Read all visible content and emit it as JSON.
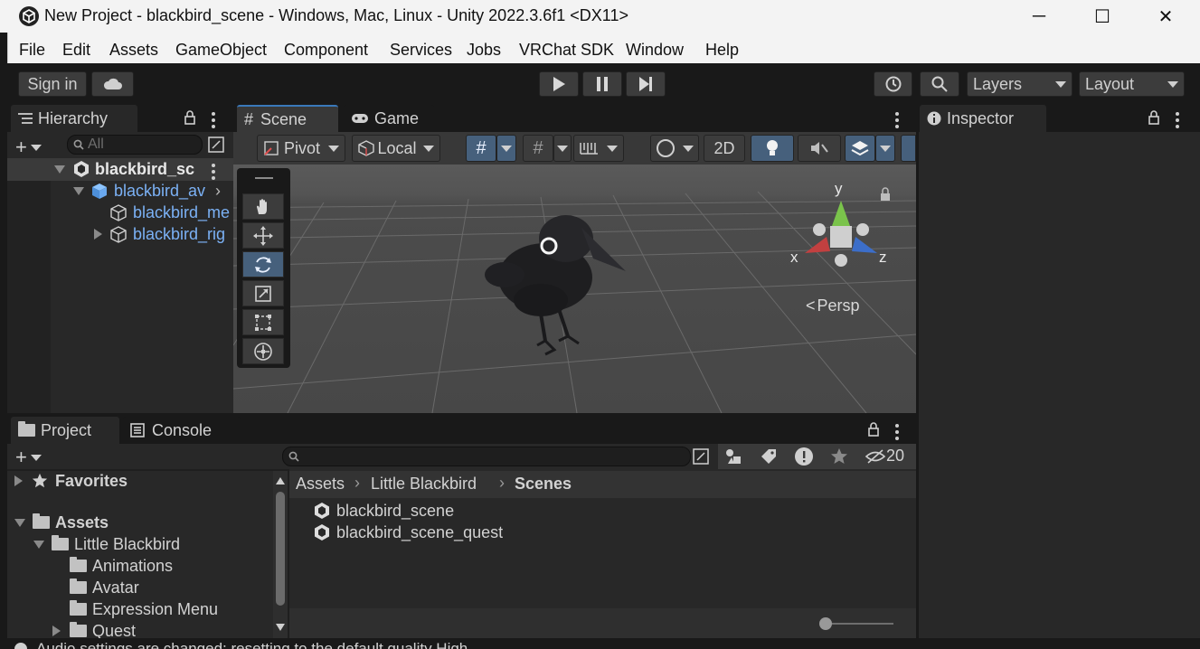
{
  "window": {
    "title": "New Project - blackbird_scene - Windows, Mac, Linux - Unity 2022.3.6f1 <DX11>",
    "minimize_glyph": "─",
    "maximize_glyph": "☐",
    "close_glyph": "✕"
  },
  "menu": [
    "File",
    "Edit",
    "Assets",
    "GameObject",
    "Component",
    "Services",
    "Jobs",
    "VRChat SDK",
    "Window",
    "Help"
  ],
  "toolbar": {
    "sign_in": "Sign in",
    "layers": "Layers",
    "layout": "Layout"
  },
  "hierarchy": {
    "tab": "Hierarchy",
    "search_placeholder": "All",
    "rows": [
      "blackbird_sc",
      "blackbird_av",
      "blackbird_me",
      "blackbird_rig"
    ]
  },
  "scene": {
    "tab_scene": "Scene",
    "tab_game": "Game",
    "pivot": "Pivot",
    "local": "Local",
    "mode_2d": "2D",
    "persp": "Persp",
    "gizmo_y": "y",
    "gizmo_x": "x",
    "gizmo_z": "z"
  },
  "inspector": {
    "tab": "Inspector"
  },
  "project": {
    "tab_project": "Project",
    "tab_console": "Console",
    "hidden_count": "20",
    "favorites": "Favorites",
    "assets": "Assets",
    "little_blackbird": "Little Blackbird",
    "folders": [
      "Animations",
      "Avatar",
      "Expression Menu",
      "Quest"
    ],
    "breadcrumb": [
      "Assets",
      "Little Blackbird",
      "Scenes"
    ],
    "files": [
      "blackbird_scene",
      "blackbird_scene_quest"
    ]
  },
  "status": {
    "message": "Audio settings are changed; resetting to the default quality High"
  },
  "colors": {
    "accent": "#3a79bb",
    "selected_tool": "#46607c",
    "prefab_blue": "#7bb1f5"
  }
}
